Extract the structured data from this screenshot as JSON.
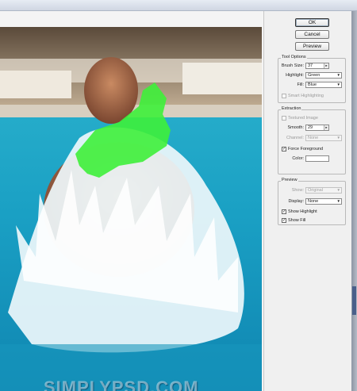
{
  "buttons": {
    "ok": "OK",
    "cancel": "Cancel",
    "preview": "Preview"
  },
  "tool_options": {
    "title": "Tool Options",
    "brush_size_label": "Brush Size:",
    "brush_size_value": "37",
    "highlight_label": "Highlight:",
    "highlight_value": "Green",
    "fill_label": "Fill:",
    "fill_value": "Blue",
    "smart_highlighting_label": "Smart Highlighting",
    "smart_highlighting_checked": false
  },
  "extraction": {
    "title": "Extraction",
    "textured_image_label": "Textured Image",
    "textured_image_checked": false,
    "smooth_label": "Smooth:",
    "smooth_value": "29",
    "channel_label": "Channel:",
    "channel_value": "None",
    "force_foreground_label": "Force Foreground",
    "force_foreground_checked": true,
    "color_label": "Color:",
    "color_value": "#ffffff"
  },
  "preview": {
    "title": "Preview",
    "show_label": "Show:",
    "show_value": "Original",
    "display_label": "Display:",
    "display_value": "None",
    "show_highlight_label": "Show Highlight",
    "show_highlight_checked": true,
    "show_fill_label": "Show Fill",
    "show_fill_checked": true
  },
  "watermark": "SIMPLYPSD.COM",
  "colors": {
    "highlight": "#3ef03a",
    "pool": "#1fa8c8",
    "panel_bg": "#f0f0f0"
  }
}
